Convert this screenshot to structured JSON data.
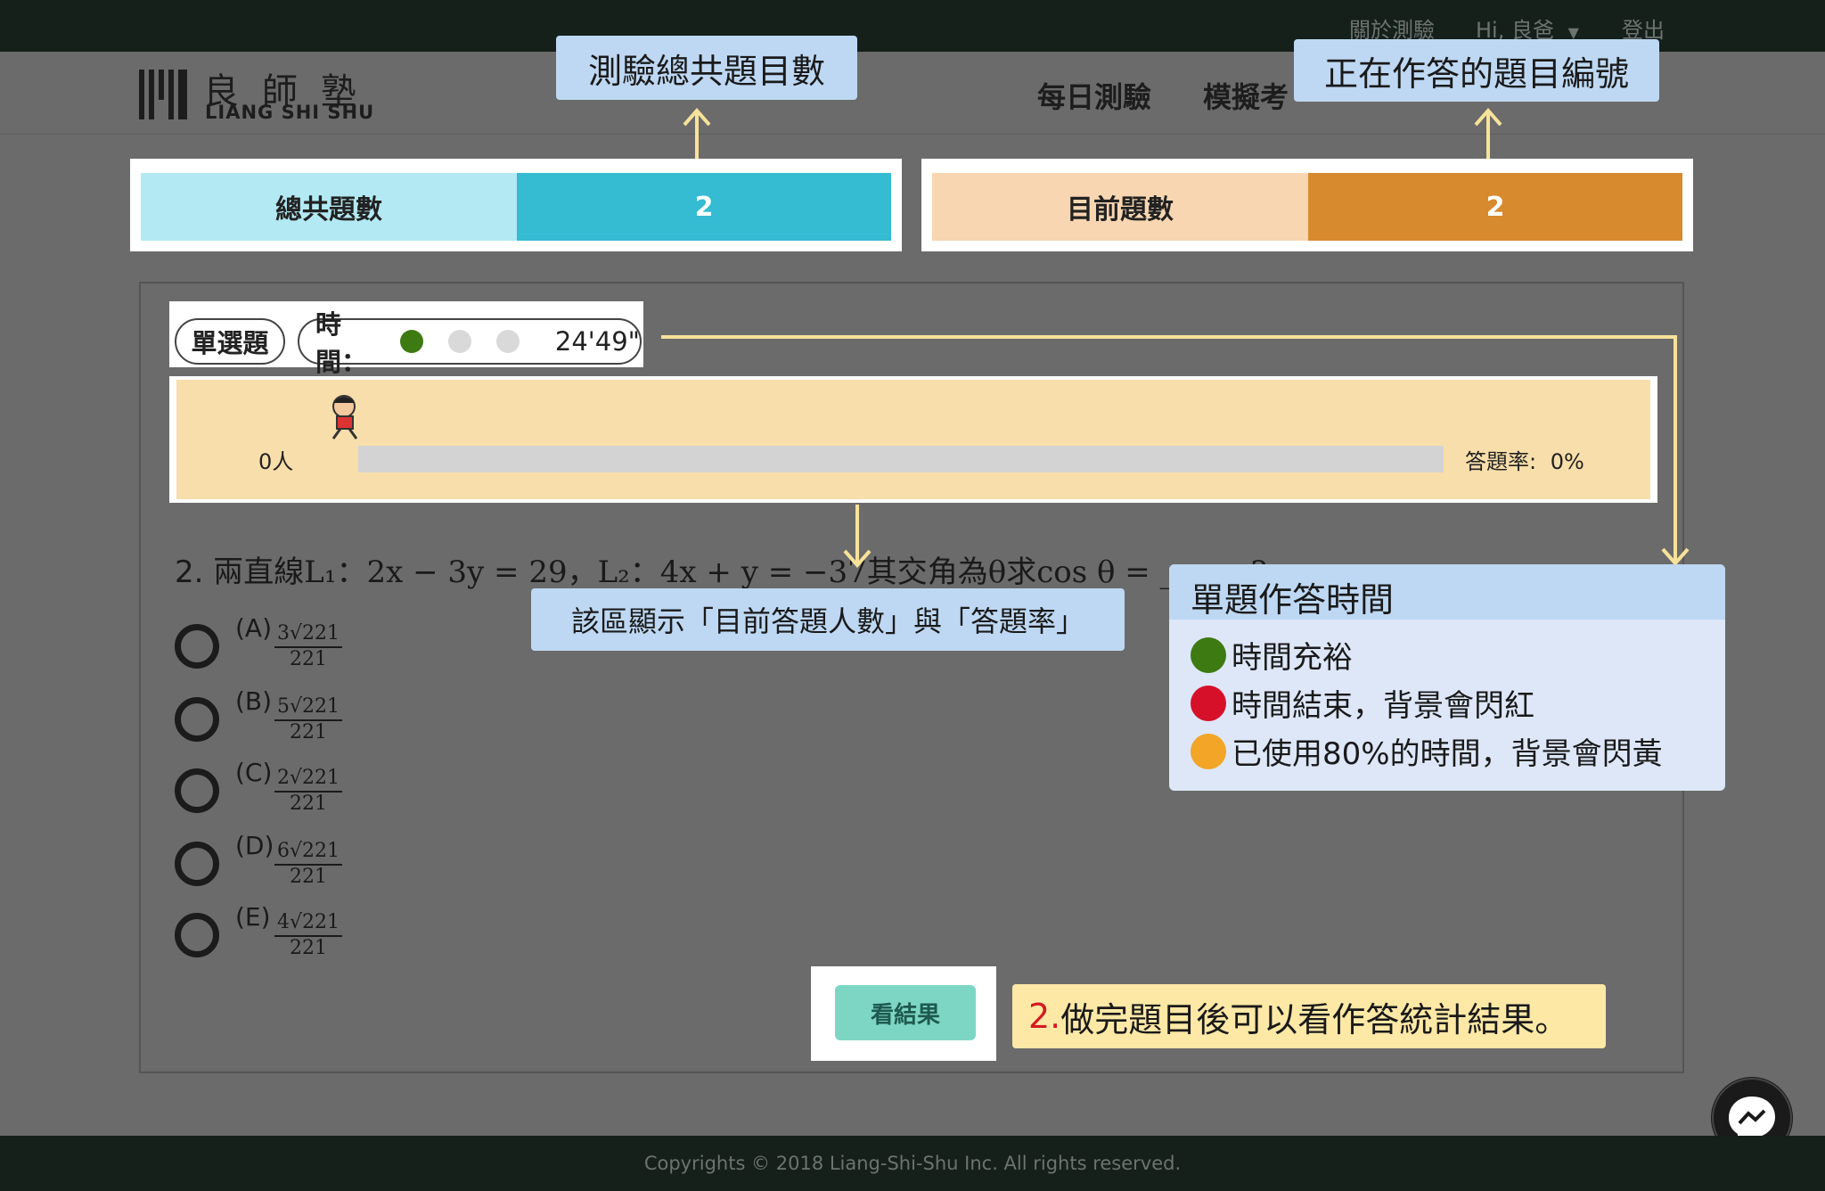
{
  "topbar": {
    "about": "關於測驗",
    "greeting": "Hi, 良爸",
    "logout": "登出"
  },
  "logo": {
    "cn": "良師塾",
    "en": "LIANG SHI SHU"
  },
  "nav": {
    "daily": "每日測驗",
    "mock": "模擬考",
    "item3": "",
    "item4": "",
    "item5": ""
  },
  "counters": {
    "total_label": "總共題數",
    "total_value": "2",
    "total_label_color": "#b3e9f3",
    "total_value_color": "#35bbd2",
    "current_label": "目前題數",
    "current_value": "2",
    "current_label_color": "#f8d6b1",
    "current_value_color": "#d78a2e"
  },
  "question_meta": {
    "type": "單選題",
    "time_label": "時間：",
    "timer": "24'49\""
  },
  "stats": {
    "count": "0人",
    "rate_label": "答題率:",
    "rate_value": "0%",
    "progress": 0
  },
  "question": {
    "number": "2.",
    "text": "兩直線L₁：2x − 3y = 29，L₂：4x + y = −37其交角為θ求cos θ = ______?"
  },
  "options": [
    {
      "letter": "(A)",
      "num": "3√221",
      "den": "221"
    },
    {
      "letter": "(B)",
      "num": "5√221",
      "den": "221"
    },
    {
      "letter": "(C)",
      "num": "2√221",
      "den": "221"
    },
    {
      "letter": "(D)",
      "num": "6√221",
      "den": "221"
    },
    {
      "letter": "(E)",
      "num": "4√221",
      "den": "221"
    }
  ],
  "result_button": "看結果",
  "callouts": {
    "total": "測驗總共題目數",
    "current": "正在作答的題目編號",
    "stats": "該區顯示「目前答題人數」與「答題率」",
    "legend_title": "單題作答時間",
    "legend": [
      {
        "color": "#3d7a12",
        "text": "時間充裕"
      },
      {
        "color": "#d7102a",
        "text": "時間結束，背景會閃紅"
      },
      {
        "color": "#f2a526",
        "text": "已使用80%的時間，背景會閃黃"
      }
    ],
    "tip_number": "2.",
    "tip_text": "做完題目後可以看作答統計結果。"
  },
  "footer": "Copyrights © 2018 Liang-Shi-Shu Inc. All rights reserved."
}
